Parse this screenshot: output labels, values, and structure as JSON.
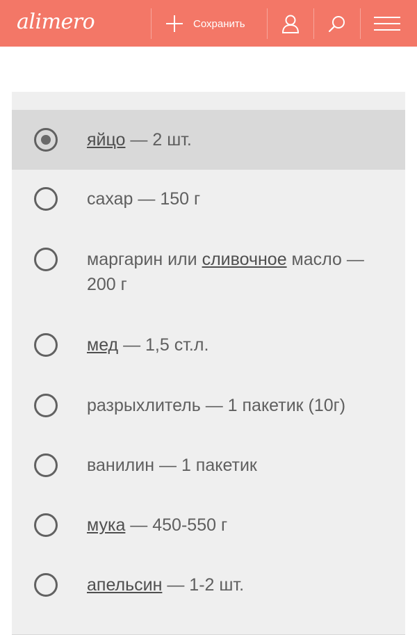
{
  "header": {
    "logo": "alimero",
    "save_label": "Сохранить",
    "icons": [
      "plus-icon",
      "user-icon",
      "search-icon",
      "menu-icon"
    ],
    "colors": {
      "bar": "#f37767",
      "selected_row": "#d9d9d9",
      "card": "#efefef"
    }
  },
  "ingredients": {
    "selected_index": 0,
    "items": [
      {
        "name": "яйцо",
        "linked": true,
        "amount": " — 2 шт."
      },
      {
        "name": "сахар",
        "linked": false,
        "amount": " — 150 г"
      },
      {
        "pre": "маргарин или ",
        "name": "сливочное",
        "linked": true,
        "amount": " масло — 200 г"
      },
      {
        "name": "мед",
        "linked": true,
        "amount": " — 1,5 ст.л."
      },
      {
        "name": "разрыхлитель",
        "linked": false,
        "amount": " — 1 пакетик (10г)"
      },
      {
        "name": "ванилин",
        "linked": false,
        "amount": " — 1 пакетик"
      },
      {
        "name": "мука",
        "linked": true,
        "amount": " — 450-550 г"
      },
      {
        "name": "апельсин",
        "linked": true,
        "amount": " — 1-2 шт."
      }
    ]
  }
}
